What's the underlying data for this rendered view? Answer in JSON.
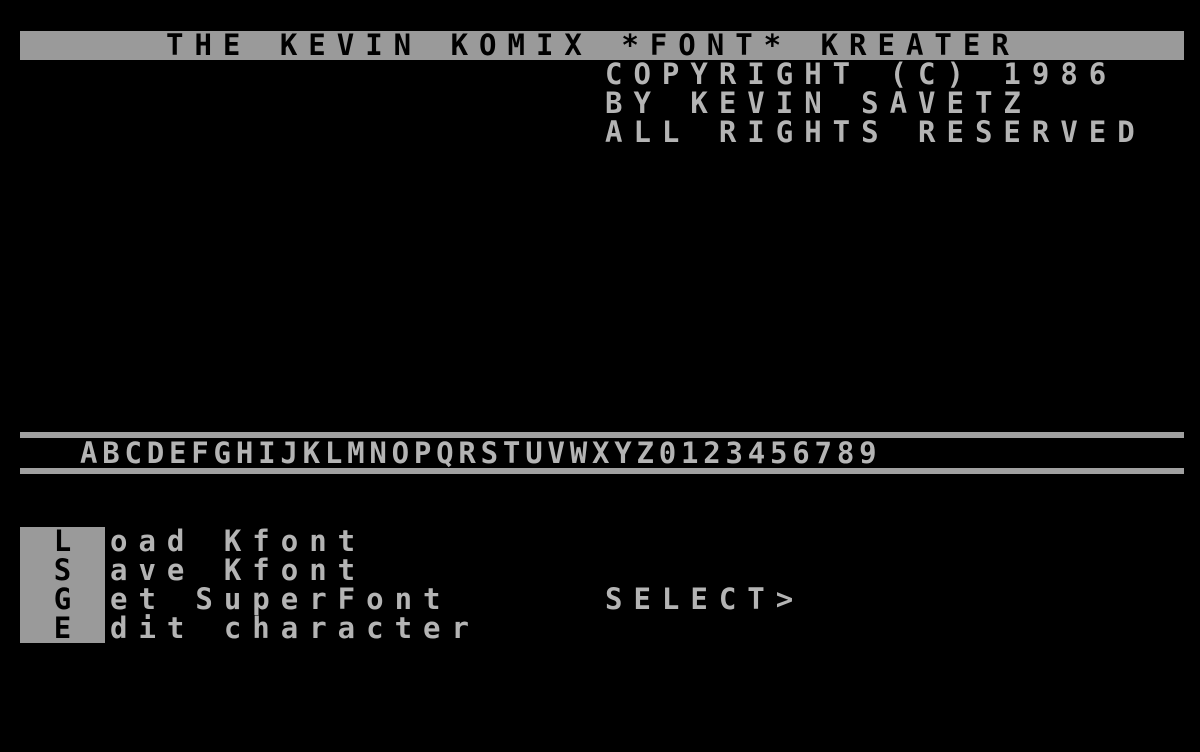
{
  "header": {
    "title": "THE KEVIN KOMIX *FONT* KREATER",
    "copyright_line1": "COPYRIGHT (C) 1986",
    "copyright_line2": "BY KEVIN SAVETZ",
    "copyright_line3": "ALL RIGHTS RESERVED"
  },
  "charset_preview": "ABCDEFGHIJKLMNOPQRSTUVWXYZ0123456789",
  "menu": {
    "items": [
      {
        "key": "L",
        "label": "oad Kfont"
      },
      {
        "key": "S",
        "label": "ave Kfont"
      },
      {
        "key": "G",
        "label": "et SuperFont"
      },
      {
        "key": "E",
        "label": "dit character"
      }
    ]
  },
  "prompt": "SELECT>",
  "colors": {
    "background": "#000000",
    "text": "#b4b4b4",
    "highlight_bar": "#9a9a9a",
    "highlight_text": "#000000"
  }
}
